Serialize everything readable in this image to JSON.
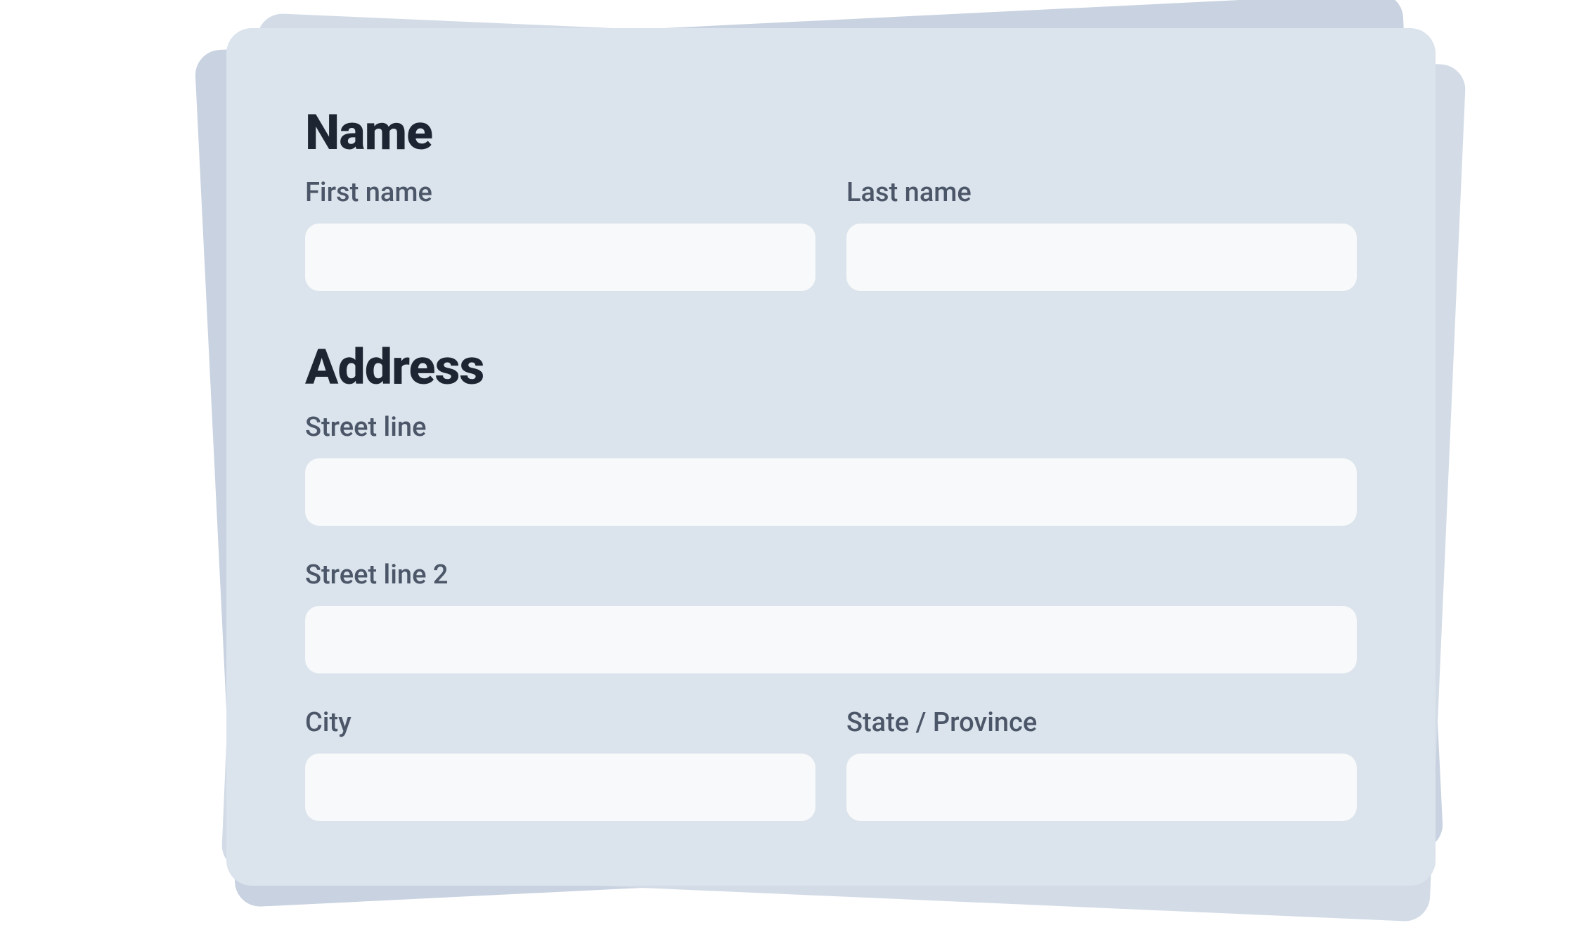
{
  "sections": {
    "name": {
      "heading": "Name",
      "first_name_label": "First name",
      "first_name_value": "",
      "last_name_label": "Last name",
      "last_name_value": ""
    },
    "address": {
      "heading": "Address",
      "street_line_label": "Street line",
      "street_line_value": "",
      "street_line_2_label": "Street line 2",
      "street_line_2_value": "",
      "city_label": "City",
      "city_value": "",
      "state_label": "State / Province",
      "state_value": ""
    }
  }
}
